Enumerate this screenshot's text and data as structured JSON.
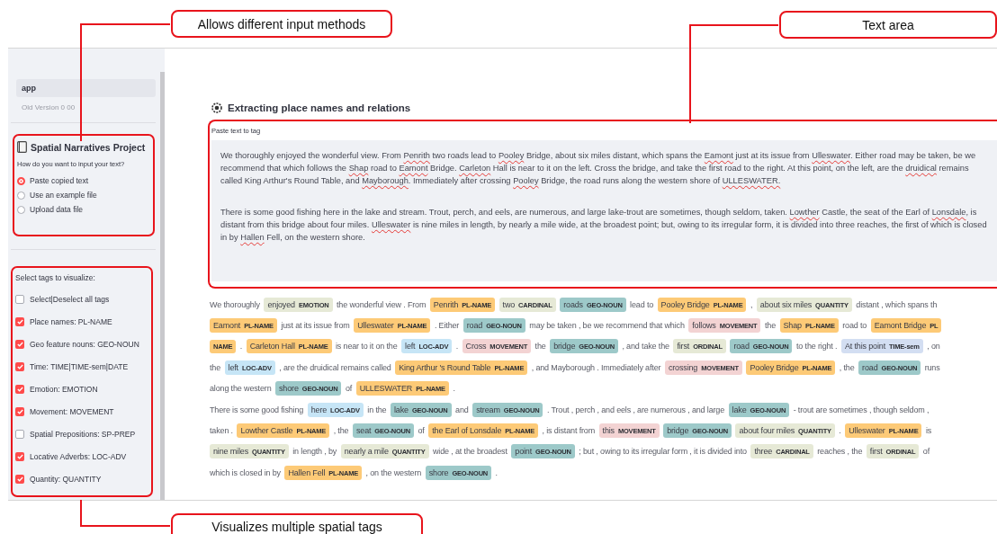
{
  "callouts": [
    {
      "kind": "input",
      "text": "Allows different input methods"
    },
    {
      "kind": "textarea",
      "text": "Text area"
    },
    {
      "kind": "tags",
      "text": "Visualizes multiple spatial tags"
    }
  ],
  "sidebar": {
    "app_item": "app",
    "version": "Old Version 0 00",
    "project_title": "Spatial Narratives Project",
    "input_question": "How do you want to input your text?",
    "input_options": [
      {
        "label": "Paste copied text",
        "selected": true
      },
      {
        "label": "Use an example file",
        "selected": false
      },
      {
        "label": "Upload data file",
        "selected": false
      }
    ],
    "tags_heading": "Select tags to visualize:",
    "tags": [
      {
        "label": "Select|Deselect all tags",
        "checked": false
      },
      {
        "label": "Place names: PL-NAME",
        "checked": true
      },
      {
        "label": "Geo feature nouns: GEO-NOUN",
        "checked": true
      },
      {
        "label": "Time: TIME|TIME-sem|DATE",
        "checked": true
      },
      {
        "label": "Emotion: EMOTION",
        "checked": true
      },
      {
        "label": "Movement: MOVEMENT",
        "checked": true
      },
      {
        "label": "Spatial Prepositions: SP-PREP",
        "checked": false
      },
      {
        "label": "Locative Adverbs: LOC-ADV",
        "checked": true
      },
      {
        "label": "Quantity: QUANTITY",
        "checked": true
      }
    ]
  },
  "main": {
    "title": "Extracting place names and relations",
    "textarea_label": "Paste text to tag",
    "paragraphs": [
      [
        {
          "text": "We thoroughly enjoyed the wonderful view. From ",
          "flagged": false
        },
        {
          "text": "Penrith",
          "flagged": true
        },
        {
          "text": " two roads lead to ",
          "flagged": false
        },
        {
          "text": "Pooley",
          "flagged": true
        },
        {
          "text": " Bridge, about six miles distant, which spans the ",
          "flagged": false
        },
        {
          "text": "Eamont",
          "flagged": true
        },
        {
          "text": " just at its issue from ",
          "flagged": false
        },
        {
          "text": "Ulleswater",
          "flagged": true
        },
        {
          "text": ". Either road may be taken, be we recommend that which follows the ",
          "flagged": false
        },
        {
          "text": "Shap",
          "flagged": true
        },
        {
          "text": " road to ",
          "flagged": false
        },
        {
          "text": "Eamont",
          "flagged": true
        },
        {
          "text": " Bridge. ",
          "flagged": false
        },
        {
          "text": "Carleton",
          "flagged": true
        },
        {
          "text": " Hall is near to it on the left. Cross the bridge, and take the first road to the right. At this point, on the left, are the ",
          "flagged": false
        },
        {
          "text": "druidical",
          "flagged": true
        },
        {
          "text": " remains called King Arthur's Round Table, and ",
          "flagged": false
        },
        {
          "text": "Mayborough",
          "flagged": true
        },
        {
          "text": ". Immediately after crossing ",
          "flagged": false
        },
        {
          "text": "Pooley",
          "flagged": true
        },
        {
          "text": " Bridge, the road runs along the western shore of ",
          "flagged": false
        },
        {
          "text": "ULLESWATER.",
          "flagged": true
        }
      ],
      [
        {
          "text": "There is some good fishing here in the lake and stream. Trout, perch, and eels, are numerous, and large lake-trout are sometimes, though seldom, taken. ",
          "flagged": false
        },
        {
          "text": "Lowther",
          "flagged": true
        },
        {
          "text": " Castle, the seat of the Earl of ",
          "flagged": false
        },
        {
          "text": "Lonsdale",
          "flagged": true
        },
        {
          "text": ", is distant from this bridge about four miles. ",
          "flagged": false
        },
        {
          "text": "Ulleswater",
          "flagged": true
        },
        {
          "text": " is nine miles in length, by nearly a mile wide, at the broadest point; but, owing to its irregular form, it is divided into three reaches, the first of which is closed in by ",
          "flagged": false
        },
        {
          "text": "Hallen",
          "flagged": true
        },
        {
          "text": " Fell, on the western shore.",
          "flagged": false
        }
      ]
    ],
    "tagged_lines": [
      [
        {
          "kind": "plain",
          "text": "We thoroughly"
        },
        {
          "kind": "chip",
          "text": "enjoyed",
          "tag": "EMOTION",
          "color": "#e6e9d6"
        },
        {
          "kind": "plain",
          "text": "the wonderful view . From"
        },
        {
          "kind": "chip",
          "text": "Penrith",
          "tag": "PL-NAME",
          "color": "#fdca77"
        },
        {
          "kind": "chip",
          "text": "two",
          "tag": "CARDINAL",
          "color": "#e6e9d6"
        },
        {
          "kind": "chip",
          "text": "roads",
          "tag": "GEO-NOUN",
          "color": "#9dc9c9"
        },
        {
          "kind": "plain",
          "text": "lead to"
        },
        {
          "kind": "chip",
          "text": "Pooley Bridge",
          "tag": "PL-NAME",
          "color": "#fdca77"
        },
        {
          "kind": "plain",
          "text": ","
        },
        {
          "kind": "chip",
          "text": "about six miles",
          "tag": "QUANTITY",
          "color": "#e6e9d6"
        },
        {
          "kind": "plain",
          "text": "distant , which spans th"
        }
      ],
      [
        {
          "kind": "chip",
          "text": "Eamont",
          "tag": "PL-NAME",
          "color": "#fdca77"
        },
        {
          "kind": "plain",
          "text": "just at its issue from"
        },
        {
          "kind": "chip",
          "text": "Ulleswater",
          "tag": "PL-NAME",
          "color": "#fdca77"
        },
        {
          "kind": "plain",
          "text": ". Either"
        },
        {
          "kind": "chip",
          "text": "road",
          "tag": "GEO-NOUN",
          "color": "#9dc9c9"
        },
        {
          "kind": "plain",
          "text": "may be taken , be we recommend that which"
        },
        {
          "kind": "chip",
          "text": "follows",
          "tag": "MOVEMENT",
          "color": "#f3d3d3"
        },
        {
          "kind": "plain",
          "text": "the"
        },
        {
          "kind": "chip",
          "text": "Shap",
          "tag": "PL-NAME",
          "color": "#fdca77"
        },
        {
          "kind": "plain",
          "text": "road to"
        },
        {
          "kind": "chip",
          "text": "Eamont Bridge",
          "tag": "PL",
          "color": "#fdca77"
        }
      ],
      [
        {
          "kind": "chip",
          "tag": "NAME",
          "color": "#fdca77"
        },
        {
          "kind": "plain",
          "text": "."
        },
        {
          "kind": "chip",
          "text": "Carleton Hall",
          "tag": "PL-NAME",
          "color": "#fdca77"
        },
        {
          "kind": "plain",
          "text": "is near to it on the"
        },
        {
          "kind": "chip",
          "text": "left",
          "tag": "LOC-ADV",
          "color": "#c6e5f6"
        },
        {
          "kind": "plain",
          "text": "."
        },
        {
          "kind": "chip",
          "text": "Cross",
          "tag": "MOVEMENT",
          "color": "#f3d3d3"
        },
        {
          "kind": "plain",
          "text": "the"
        },
        {
          "kind": "chip",
          "text": "bridge",
          "tag": "GEO-NOUN",
          "color": "#9dc9c9"
        },
        {
          "kind": "plain",
          "text": ", and take the"
        },
        {
          "kind": "chip",
          "text": "first",
          "tag": "ORDINAL",
          "color": "#e6e9d6"
        },
        {
          "kind": "chip",
          "text": "road",
          "tag": "GEO-NOUN",
          "color": "#9dc9c9"
        },
        {
          "kind": "plain",
          "text": "to the right ."
        },
        {
          "kind": "chip",
          "text": "At this point",
          "tag": "TIME-sem",
          "color": "#d3def2"
        },
        {
          "kind": "plain",
          "text": ", on"
        }
      ],
      [
        {
          "kind": "plain",
          "text": "the"
        },
        {
          "kind": "chip",
          "text": "left",
          "tag": "LOC-ADV",
          "color": "#c6e5f6"
        },
        {
          "kind": "plain",
          "text": ", are the druidical remains called"
        },
        {
          "kind": "chip",
          "text": "King Arthur 's Round Table",
          "tag": "PL-NAME",
          "color": "#fdca77"
        },
        {
          "kind": "plain",
          "text": ", and Mayborough . Immediately after"
        },
        {
          "kind": "chip",
          "text": "crossing",
          "tag": "MOVEMENT",
          "color": "#f3d3d3"
        },
        {
          "kind": "chip",
          "text": "Pooley Bridge",
          "tag": "PL-NAME",
          "color": "#fdca77"
        },
        {
          "kind": "plain",
          "text": ", the"
        },
        {
          "kind": "chip",
          "text": "road",
          "tag": "GEO-NOUN",
          "color": "#9dc9c9"
        },
        {
          "kind": "plain",
          "text": "runs"
        }
      ],
      [
        {
          "kind": "plain",
          "text": "along the western"
        },
        {
          "kind": "chip",
          "text": "shore",
          "tag": "GEO-NOUN",
          "color": "#9dc9c9"
        },
        {
          "kind": "plain",
          "text": "of"
        },
        {
          "kind": "chip",
          "text": "ULLESWATER",
          "tag": "PL-NAME",
          "color": "#fdca77"
        },
        {
          "kind": "plain",
          "text": "."
        }
      ],
      [
        {
          "kind": "plain",
          "text": "There is some good fishing"
        },
        {
          "kind": "chip",
          "text": "here",
          "tag": "LOC-ADV",
          "color": "#c6e5f6"
        },
        {
          "kind": "plain",
          "text": "in the"
        },
        {
          "kind": "chip",
          "text": "lake",
          "tag": "GEO-NOUN",
          "color": "#9dc9c9"
        },
        {
          "kind": "plain",
          "text": "and"
        },
        {
          "kind": "chip",
          "text": "stream",
          "tag": "GEO-NOUN",
          "color": "#9dc9c9"
        },
        {
          "kind": "plain",
          "text": ". Trout , perch , and eels , are numerous , and large"
        },
        {
          "kind": "chip",
          "text": "lake",
          "tag": "GEO-NOUN",
          "color": "#9dc9c9"
        },
        {
          "kind": "plain",
          "text": "- trout are sometimes , though seldom ,"
        }
      ],
      [
        {
          "kind": "plain",
          "text": "taken ."
        },
        {
          "kind": "chip",
          "text": "Lowther Castle",
          "tag": "PL-NAME",
          "color": "#fdca77"
        },
        {
          "kind": "plain",
          "text": ", the"
        },
        {
          "kind": "chip",
          "text": "seat",
          "tag": "GEO-NOUN",
          "color": "#9dc9c9"
        },
        {
          "kind": "plain",
          "text": "of"
        },
        {
          "kind": "chip",
          "text": "the Earl of Lonsdale",
          "tag": "PL-NAME",
          "color": "#fdca77"
        },
        {
          "kind": "plain",
          "text": ", is distant from"
        },
        {
          "kind": "chip",
          "text": "this",
          "tag": "MOVEMENT",
          "color": "#f3d3d3"
        },
        {
          "kind": "chip",
          "text": "bridge",
          "tag": "GEO-NOUN",
          "color": "#9dc9c9"
        },
        {
          "kind": "chip",
          "text": "about four miles",
          "tag": "QUANTITY",
          "color": "#e6e9d6"
        },
        {
          "kind": "plain",
          "text": "."
        },
        {
          "kind": "chip",
          "text": "Ulleswater",
          "tag": "PL-NAME",
          "color": "#fdca77"
        },
        {
          "kind": "plain",
          "text": "is"
        }
      ],
      [
        {
          "kind": "chip",
          "text": "nine miles",
          "tag": "QUANTITY",
          "color": "#e6e9d6"
        },
        {
          "kind": "plain",
          "text": "in length , by"
        },
        {
          "kind": "chip",
          "text": "nearly a mile",
          "tag": "QUANTITY",
          "color": "#e6e9d6"
        },
        {
          "kind": "plain",
          "text": "wide , at the broadest"
        },
        {
          "kind": "chip",
          "text": "point",
          "tag": "GEO-NOUN",
          "color": "#9dc9c9"
        },
        {
          "kind": "plain",
          "text": "; but , owing to its irregular form , it is divided into"
        },
        {
          "kind": "chip",
          "text": "three",
          "tag": "CARDINAL",
          "color": "#e6e9d6"
        },
        {
          "kind": "plain",
          "text": "reaches , the"
        },
        {
          "kind": "chip",
          "text": "first",
          "tag": "ORDINAL",
          "color": "#e6e9d6"
        },
        {
          "kind": "plain",
          "text": "of"
        }
      ],
      [
        {
          "kind": "plain",
          "text": "which is closed in by"
        },
        {
          "kind": "chip",
          "text": "Hallen Fell",
          "tag": "PL-NAME",
          "color": "#fdca77"
        },
        {
          "kind": "plain",
          "text": ", on the western"
        },
        {
          "kind": "chip",
          "text": "shore",
          "tag": "GEO-NOUN",
          "color": "#9dc9c9"
        },
        {
          "kind": "plain",
          "text": "."
        }
      ]
    ]
  }
}
